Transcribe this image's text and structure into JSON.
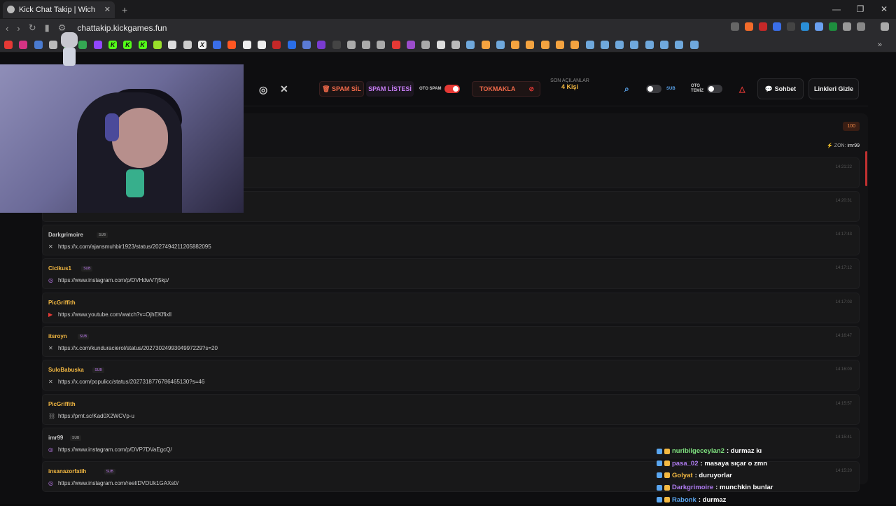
{
  "browser": {
    "tab_title": "Kick Chat Takip | Wich",
    "url": "chattakip.kickgames.fun"
  },
  "nav": {
    "spam_sil": "SPAM SİL",
    "spam_listesi": "SPAM LİSTESİ",
    "oto_spam": "OTO SPAM",
    "oto_spam_on": true,
    "tokmakla": "TOKMAKLA",
    "son_acilanlar_label": "SON AÇILANLAR",
    "son_acilanlar_value": "4 Kişi",
    "sub_label": "SUB",
    "sub_on": false,
    "oto_temiz_label": "OTO TEMİZ",
    "oto_temiz_on": false,
    "sohbet": "Sohbet",
    "linkleri_gizle": "Linkleri Gizle"
  },
  "panel": {
    "count": "100",
    "zon_label": "ZON:",
    "zon_user": "imr99"
  },
  "messages": [
    {
      "user": "Darkgrimoire",
      "sub": "SUB",
      "color": "#c8c8c8",
      "icon": "x-icon",
      "link": "https://x.com/ajansmuhbir1923/status/2027494211205882095",
      "time": "14:17:43"
    },
    {
      "user": "Cicikus1",
      "sub": "SUB",
      "color": "#f4b942",
      "icon": "instagram-icon",
      "link": "https://www.instagram.com/p/DVHdwV7j5kp/",
      "time": "14:17:12"
    },
    {
      "user": "PicGriffith",
      "sub": "",
      "color": "#f4b942",
      "icon": "youtube-icon",
      "link": "https://www.youtube.com/watch?v=OjhEKffixll",
      "time": "14:17:03"
    },
    {
      "user": "itsroyn",
      "sub": "SUB",
      "color": "#f4b942",
      "icon": "x-icon",
      "link": "https://x.com/kunduracierol/status/2027302499304997229?s=20",
      "time": "14:16:47"
    },
    {
      "user": "SuloBabuska",
      "sub": "SUB",
      "color": "#f4b942",
      "icon": "x-icon",
      "link": "https://x.com/populicc/status/2027318776786465130?s=46",
      "time": "14:16:09"
    },
    {
      "user": "PicGriffith",
      "sub": "",
      "color": "#f4b942",
      "icon": "link-icon",
      "link": "https://prnt.sc/Kad0X2WCVp-u",
      "time": "14:15:57"
    },
    {
      "user": "imr99",
      "sub": "SUB",
      "color": "#c8c8c8",
      "icon": "instagram-icon",
      "link": "https://www.instagram.com/p/DVP7DVaEgcQ/",
      "time": "14:15:41"
    },
    {
      "user": "insanazorfatih",
      "sub": "SUB",
      "color": "#f4b942",
      "icon": "instagram-icon",
      "link": "https://www.instagram.com/reel/DVDUk1GAXs0/",
      "time": "14:15:20"
    }
  ],
  "hidden_rows": [
    {
      "time": "14:21:22"
    },
    {
      "time": "14:20:31"
    }
  ],
  "overlay_chat": [
    {
      "user": "nuribilgeceylan2",
      "text": ": durmaz kı",
      "color": "#7ee07e"
    },
    {
      "user": "pasa_02",
      "text": ": masaya sıçar o zmn",
      "color": "#b07cf2"
    },
    {
      "user": "Golyat",
      "text": ": duruyorlar",
      "color": "#f4b942"
    },
    {
      "user": "Darkgrimoire",
      "text": ": munchkin bunlar",
      "color": "#b07cf2"
    },
    {
      "user": "Rabonk",
      "text": ": durmaz",
      "color": "#5aa6f0"
    }
  ]
}
